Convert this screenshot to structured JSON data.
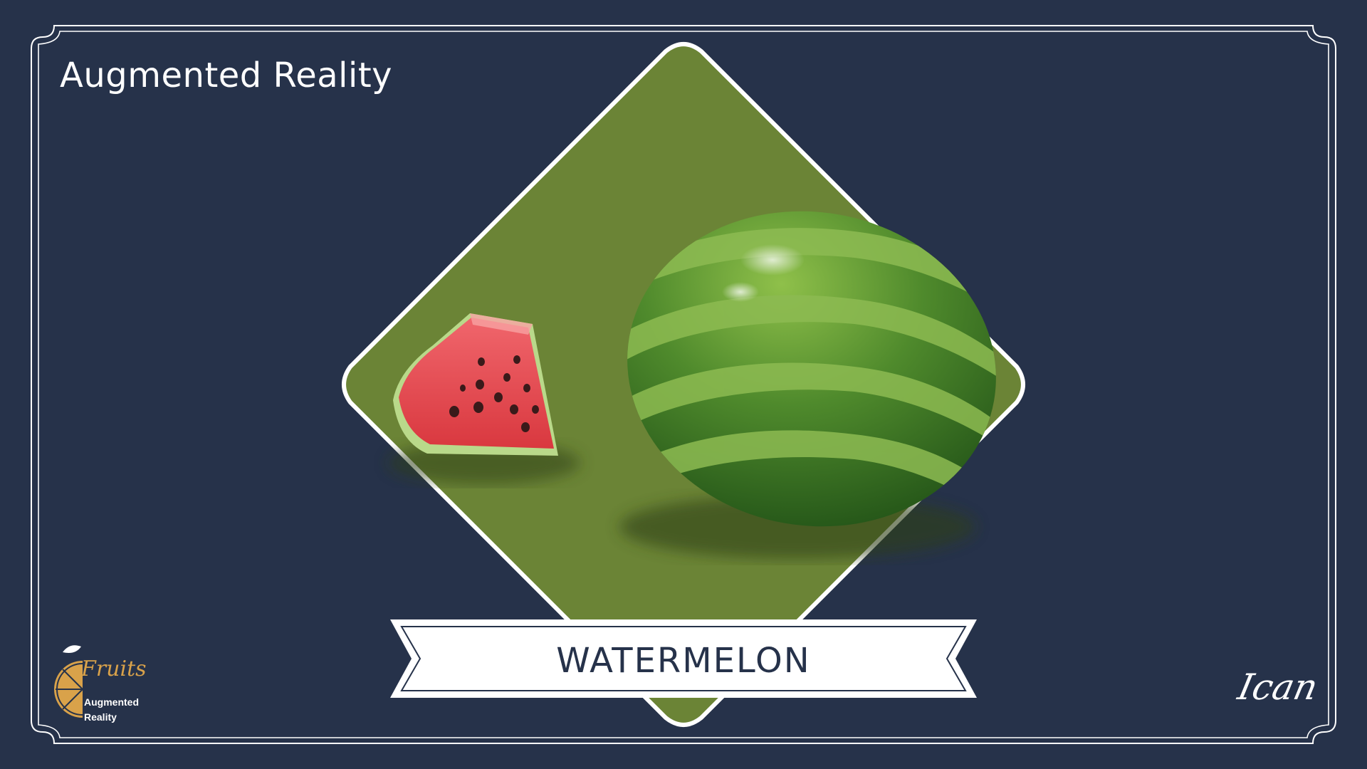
{
  "slide": {
    "title": "Augmented Reality",
    "fruit_name": "WATERMELON",
    "signature": "Ican"
  },
  "logo": {
    "script_word": "Fruits",
    "line1": "Augmented",
    "line2": "Reality"
  },
  "colors": {
    "background": "#26324a",
    "diamond_green": "#6b8436",
    "frame_line": "#ffffff",
    "banner_fill": "#ffffff",
    "banner_text": "#26324a",
    "logo_orange": "#d9a24a"
  },
  "icons": {
    "logo": "orange-slice-icon",
    "fruit_whole": "watermelon-illustration",
    "fruit_slice": "watermelon-slice-illustration"
  }
}
